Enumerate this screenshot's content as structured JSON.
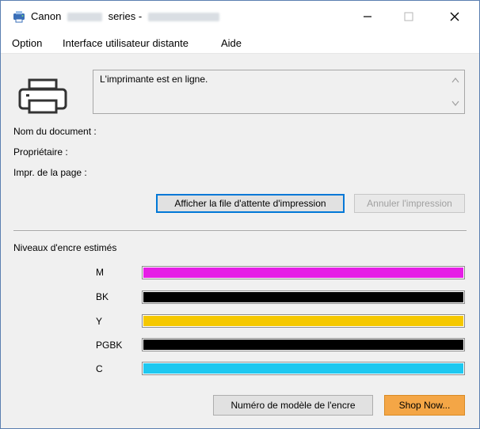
{
  "window": {
    "title_prefix": "Canon",
    "title_middle": "series -"
  },
  "menu": {
    "items": [
      "Option",
      "Interface utilisateur distante",
      "Aide"
    ]
  },
  "status": {
    "message": "L'imprimante est en ligne."
  },
  "fields": {
    "document_label": "Nom du document :",
    "owner_label": "Propriétaire :",
    "page_label": "Impr. de la page :"
  },
  "buttons": {
    "queue": "Afficher la file d'attente d'impression",
    "cancel": "Annuler l'impression",
    "ink_model": "Numéro de modèle de l'encre",
    "shop": "Shop Now..."
  },
  "ink": {
    "title": "Niveaux d'encre estimés",
    "levels": [
      {
        "name": "M",
        "color": "#e61ee6",
        "level": 1.0
      },
      {
        "name": "BK",
        "color": "#000000",
        "level": 1.0
      },
      {
        "name": "Y",
        "color": "#f5c800",
        "level": 1.0
      },
      {
        "name": "PGBK",
        "color": "#000000",
        "level": 1.0
      },
      {
        "name": "C",
        "color": "#1ec8f0",
        "level": 1.0
      }
    ]
  },
  "icons": {
    "app": "canon-printer-app-icon",
    "printer": "printer-icon",
    "minimize": "minimize-icon",
    "maximize": "maximize-icon",
    "close": "close-icon"
  }
}
